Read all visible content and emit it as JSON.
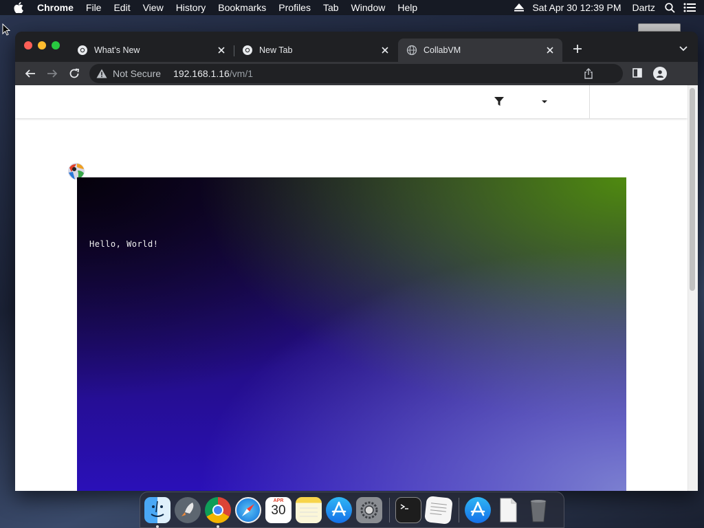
{
  "menubar": {
    "app_name": "Chrome",
    "menus": [
      "File",
      "Edit",
      "View",
      "History",
      "Bookmarks",
      "Profiles",
      "Tab",
      "Window",
      "Help"
    ],
    "clock": "Sat Apr 30  12:39 PM",
    "user": "Dartz"
  },
  "browser": {
    "tabs": [
      {
        "title": "What’s New",
        "active": false
      },
      {
        "title": "New Tab",
        "active": false
      },
      {
        "title": "CollabVM",
        "active": true
      }
    ],
    "omnibox": {
      "security_label": "Not Secure",
      "host": "192.168.1.16",
      "path": "/vm/1"
    }
  },
  "page": {
    "vm_screen_text": "Hello, World!"
  },
  "dock": {
    "items": [
      {
        "name": "Finder",
        "running": true
      },
      {
        "name": "Launchpad",
        "running": false
      },
      {
        "name": "Google Chrome",
        "running": true
      },
      {
        "name": "Safari",
        "running": false
      },
      {
        "name": "Calendar",
        "running": false,
        "month": "APR",
        "day": "30"
      },
      {
        "name": "Notes",
        "running": false
      },
      {
        "name": "App Store",
        "running": false
      },
      {
        "name": "System Preferences",
        "running": false
      },
      {
        "name": "Terminal",
        "running": false
      },
      {
        "name": "TextEdit",
        "running": false
      },
      {
        "name": "Applications",
        "running": false
      },
      {
        "name": "Document",
        "running": false
      },
      {
        "name": "Trash",
        "running": false
      }
    ]
  },
  "colors": {
    "accent_red": "#ff5f57",
    "accent_yellow": "#febc2e",
    "accent_green": "#28c840"
  }
}
